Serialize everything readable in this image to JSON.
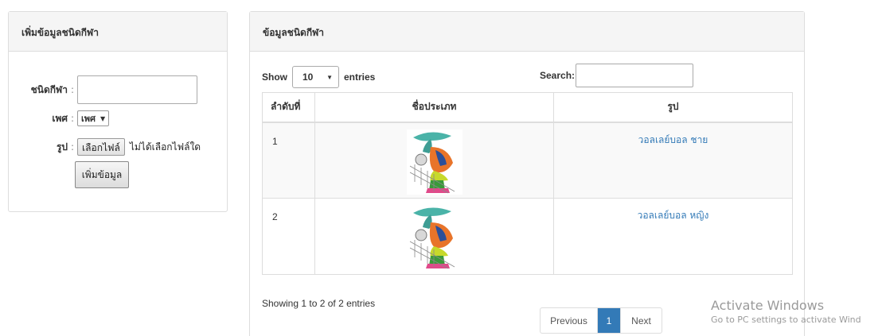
{
  "add_panel": {
    "title": "เพิ่มข้อมูลชนิดกีฬา",
    "sport_type_label": "ชนิดกีฬา",
    "sport_type_value": "",
    "gender_label": "เพศ",
    "gender_selected": "เพศ",
    "image_label": "รูป",
    "file_button_label": "เลือกไฟล์",
    "file_status": "ไม่ได้เลือกไฟล์ใด",
    "submit_label": "เพิ่มข้อมูล"
  },
  "list_panel": {
    "title": "ข้อมูลชนิดกีฬา",
    "length": {
      "prefix": "Show",
      "selected": "10",
      "suffix": "entries"
    },
    "search": {
      "label": "Search:",
      "value": ""
    },
    "columns": [
      "ลำดับที่",
      "ชื่อประเภท",
      "รูป"
    ],
    "rows": [
      {
        "no": "1",
        "image": "volleyball-player-icon",
        "name": "วอลเลย์บอล ชาย"
      },
      {
        "no": "2",
        "image": "volleyball-player-icon",
        "name": "วอลเลย์บอล หญิง"
      }
    ],
    "info": "Showing 1 to 2 of 2 entries",
    "pagination": {
      "previous": "Previous",
      "current": "1",
      "next": "Next"
    }
  },
  "watermark": {
    "line1": "Activate Windows",
    "line2": "Go to PC settings to activate Wind"
  }
}
